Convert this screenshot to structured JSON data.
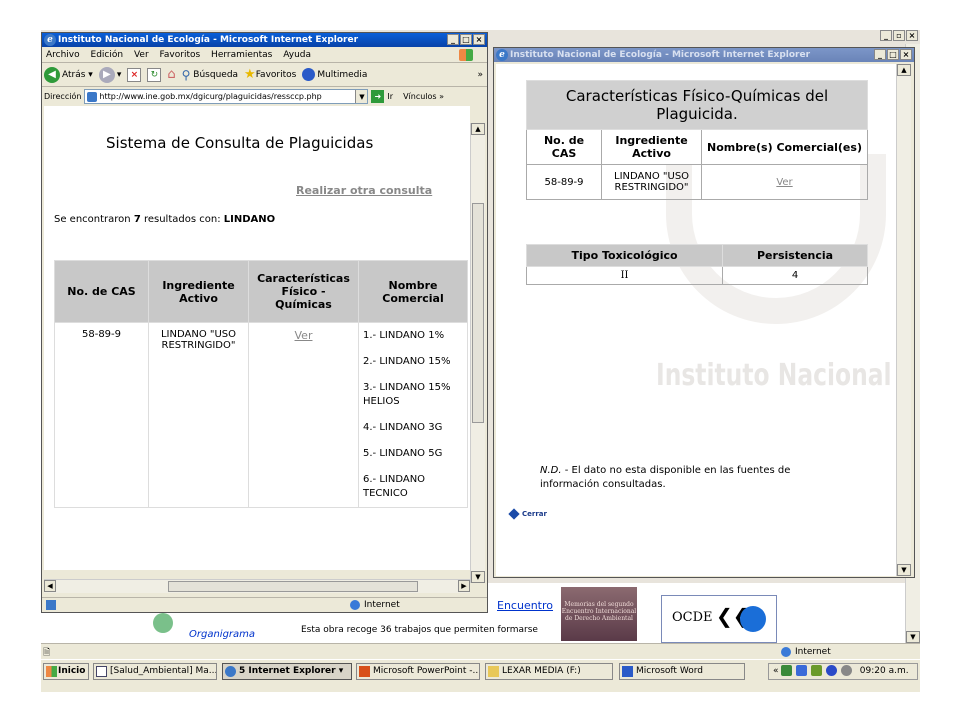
{
  "left_window": {
    "title": "Instituto Nacional de Ecología - Microsoft Internet Explorer",
    "menu": [
      "Archivo",
      "Edición",
      "Ver",
      "Favoritos",
      "Herramientas",
      "Ayuda"
    ],
    "toolbar": {
      "back": "Atrás",
      "search": "Búsqueda",
      "favorites": "Favoritos",
      "multimedia": "Multimedia"
    },
    "address_label": "Dirección",
    "address": "http://www.ine.gob.mx/dgicurg/plaguicidas/ressccp.php",
    "go_label": "Ir",
    "links_label": "Vínculos",
    "page": {
      "heading": "Sistema de Consulta de Plaguicidas",
      "new_query_link": "Realizar otra consulta",
      "result_prefix": "Se encontraron ",
      "result_count": "7",
      "result_mid": " resultados con: ",
      "result_term": "LINDANO",
      "table_headers": [
        "No. de CAS",
        "Ingrediente Activo",
        "Características Físico - Químicas",
        "Nombre Comercial"
      ],
      "row": {
        "cas": "58-89-9",
        "ingredient": "LINDANO \"USO RESTRINGIDO\"",
        "link": "Ver",
        "names": [
          "1.- LINDANO 1%",
          "2.- LINDANO 15%",
          "3.- LINDANO 15% HELIOS",
          "4.- LINDANO 3G",
          "5.- LINDANO 5G",
          "6.- LINDANO TECNICO"
        ]
      }
    },
    "status": "Internet"
  },
  "right_window": {
    "title": "Instituto Nacional de Ecología - Microsoft Internet Explorer",
    "page": {
      "heading": "Características Físico-Químicas del Plaguicida.",
      "headers": [
        "No. de CAS",
        "Ingrediente Activo",
        "Nombre(s) Comercial(es)"
      ],
      "row": {
        "cas": "58-89-9",
        "ingredient": "LINDANO \"USO RESTRINGIDO\"",
        "link": "Ver"
      },
      "tox_headers": [
        "Tipo Toxicológico",
        "Persistencia"
      ],
      "tox_row": {
        "type": "II",
        "persistence": "4"
      },
      "watermark": "Instituto Nacional",
      "note_prefix": "N.D.",
      "note_text": " - El dato no esta disponible en las fuentes de información consultadas.",
      "close_label": "Cerrar"
    }
  },
  "background_page": {
    "encuentro_link": "Encuentro",
    "organigrama_link": "Organigrama",
    "obra_text": "Esta obra recoge 36 trabajos que permiten formarse",
    "book_text": "Memorias del segundo Encuentro Internacional de Derecho Ambiental",
    "ocde_text": "OCDE",
    "status": "Internet"
  },
  "taskbar": {
    "start": "Inicio",
    "tasks": [
      "[Salud_Ambiental] Ma...",
      "5 Internet Explorer",
      "Microsoft PowerPoint -...",
      "LEXAR MEDIA (F:)",
      "Microsoft Word"
    ],
    "clock": "09:20 a.m."
  }
}
